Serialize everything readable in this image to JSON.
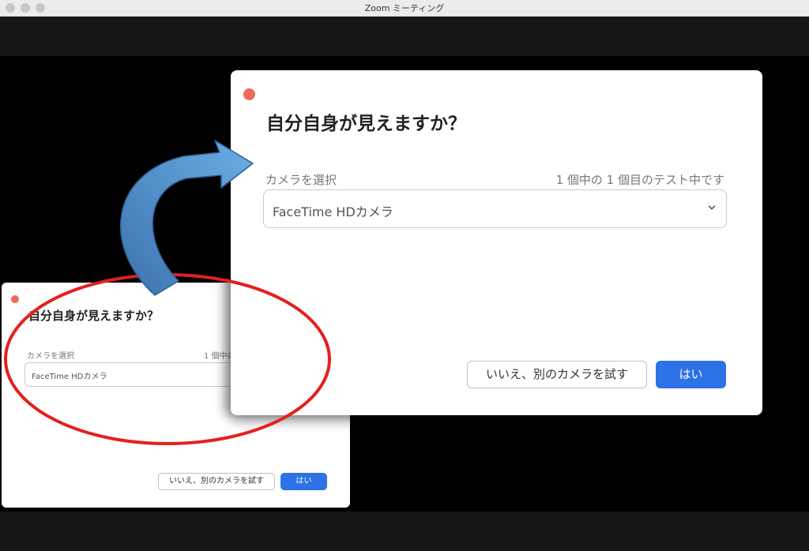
{
  "window": {
    "title": "Zoom ミーティング"
  },
  "dialog": {
    "title": "自分自身が見えますか？",
    "camera_label": "カメラを選択",
    "status": "1 個中の 1 個目のテスト中です",
    "camera_select_value": "FaceTime HDカメラ",
    "no_button": "いいえ、別のカメラを試す",
    "yes_button": "はい"
  },
  "small_dialog": {
    "status_visible": "1 個中の"
  },
  "colors": {
    "accent": "#2d72e6",
    "close": "#ec6a5e",
    "annotation_ellipse": "#e3211c",
    "annotation_arrow": "#5b9bd5"
  },
  "icons": {
    "close": "close-dot-icon",
    "chevron": "chevron-down-icon",
    "arrow": "curved-arrow-icon"
  }
}
